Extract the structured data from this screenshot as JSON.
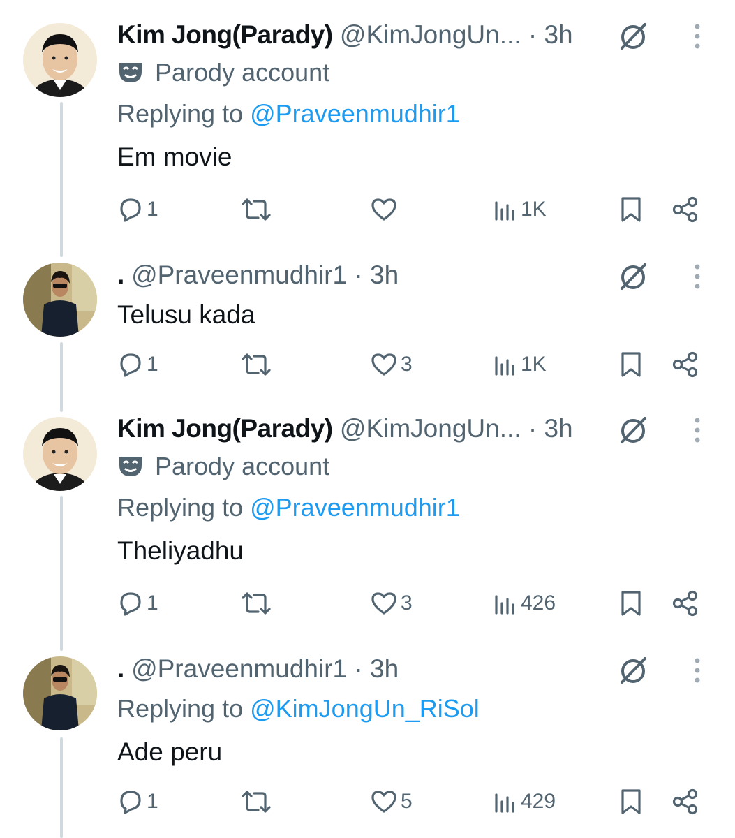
{
  "tweets": [
    {
      "display_name": "Kim Jong(Parady)",
      "handle": "@KimJongUn...",
      "time": "· 3h",
      "parody_label": "Parody account",
      "replying_prefix": "Replying to",
      "replying_to": "@Praveenmudhir1",
      "text": "Em movie",
      "replies": "1",
      "retweets": "",
      "likes": "",
      "views": "1K"
    },
    {
      "display_name": ".",
      "handle": "@Praveenmudhir1",
      "time": "· 3h",
      "text": "Telusu kada",
      "replies": "1",
      "retweets": "",
      "likes": "3",
      "views": "1K"
    },
    {
      "display_name": "Kim Jong(Parady)",
      "handle": "@KimJongUn...",
      "time": "· 3h",
      "parody_label": "Parody account",
      "replying_prefix": "Replying to",
      "replying_to": "@Praveenmudhir1",
      "text": "Theliyadhu",
      "replies": "1",
      "retweets": "",
      "likes": "3",
      "views": "426"
    },
    {
      "display_name": ".",
      "handle": "@Praveenmudhir1",
      "time": "· 3h",
      "replying_prefix": "Replying to",
      "replying_to": "@KimJongUn_RiSol",
      "text": "Ade peru",
      "replies": "1",
      "retweets": "",
      "likes": "5",
      "views": "429"
    }
  ],
  "colors": {
    "link": "#1d9bf0",
    "secondary": "#536471",
    "text": "#0f1419",
    "thread_line": "#cfd9de"
  },
  "icons": [
    "reply-icon",
    "retweet-icon",
    "like-icon",
    "views-icon",
    "bookmark-icon",
    "share-icon",
    "grok-icon",
    "more-icon",
    "parody-mask-icon"
  ]
}
